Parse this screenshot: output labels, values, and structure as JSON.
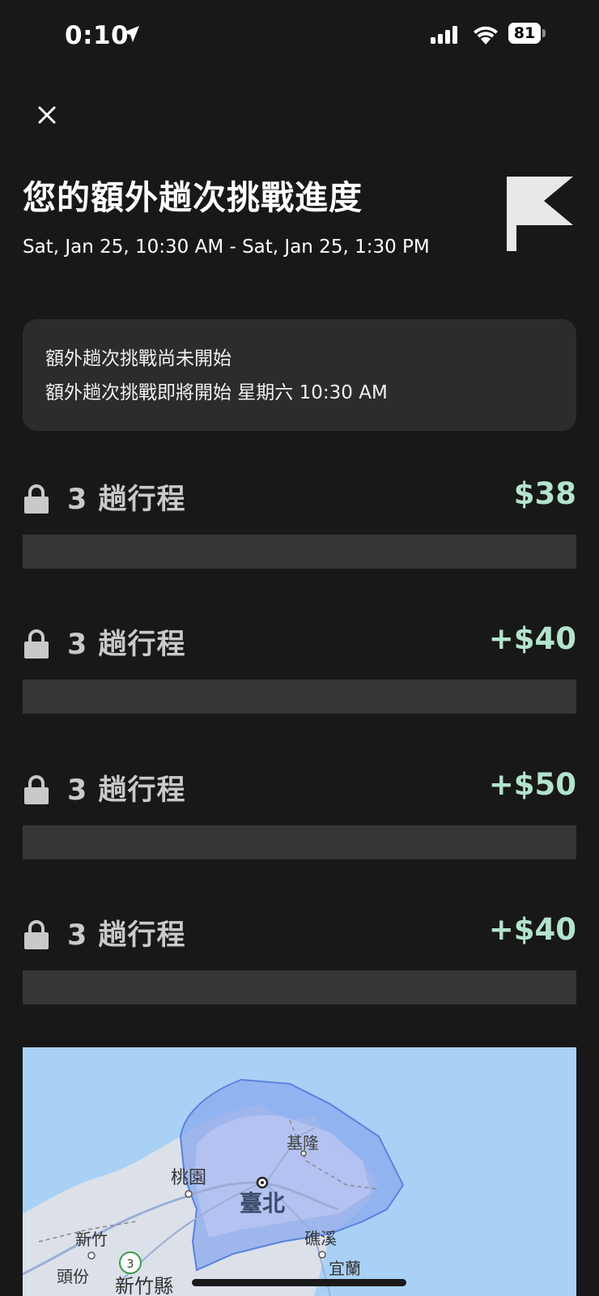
{
  "status_bar": {
    "time": "0:10",
    "battery": "81"
  },
  "header": {
    "title": "您的額外趟次挑戰進度",
    "date_range": "Sat, Jan 25, 10:30 AM - Sat, Jan 25, 1:30 PM"
  },
  "notice": {
    "line1": "額外趟次挑戰尚未開始",
    "line2": "額外趟次挑戰即將開始 星期六 10:30 AM"
  },
  "tiers": [
    {
      "label": "3 趟行程",
      "reward": "$38",
      "progress": 0
    },
    {
      "label": "3 趟行程",
      "reward": "+$40",
      "progress": 0
    },
    {
      "label": "3 趟行程",
      "reward": "+$50",
      "progress": 0
    },
    {
      "label": "3 趟行程",
      "reward": "+$40",
      "progress": 0
    }
  ],
  "map": {
    "labels": {
      "keelung": "基隆",
      "taoyuan": "桃園",
      "taipei": "臺北",
      "hsinchu": "新竹",
      "jiaoxi": "礁溪",
      "yilan": "宜蘭",
      "toufen": "頭份",
      "hsinchu_county": "新竹縣",
      "route": "3"
    }
  },
  "colors": {
    "accent_green": "#b3e3cc",
    "background": "#181818",
    "card": "#2c2c2c"
  }
}
